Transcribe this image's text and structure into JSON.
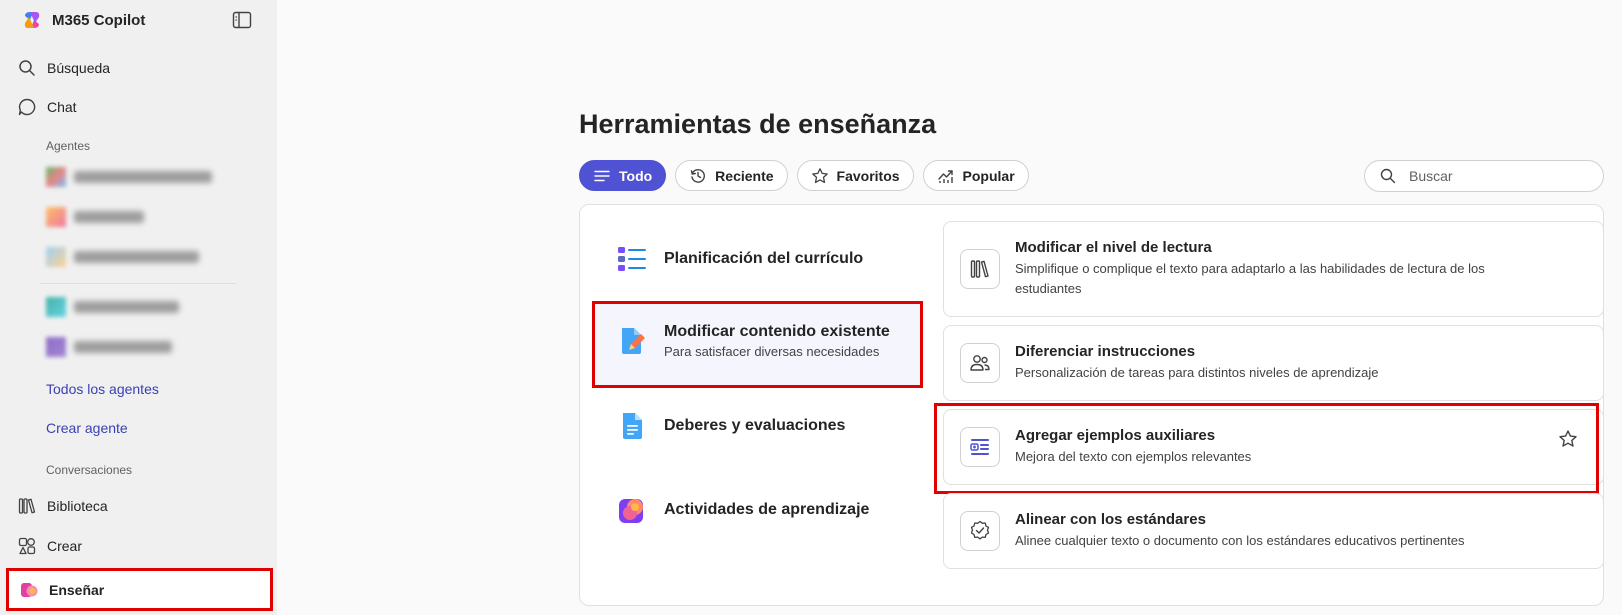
{
  "app": {
    "name": "M365 Copilot"
  },
  "sidebar": {
    "search_label": "Búsqueda",
    "chat_label": "Chat",
    "agents_heading": "Agentes",
    "all_agents_link": "Todos los agentes",
    "create_agent_link": "Crear agente",
    "conversations_heading": "Conversaciones",
    "library_label": "Biblioteca",
    "create_label": "Crear",
    "teach_label": "Enseñar"
  },
  "main": {
    "title": "Herramientas de enseñanza",
    "filters": [
      {
        "label": "Todo",
        "active": true
      },
      {
        "label": "Reciente",
        "active": false
      },
      {
        "label": "Favoritos",
        "active": false
      },
      {
        "label": "Popular",
        "active": false
      }
    ],
    "search_placeholder": "Buscar",
    "categories": [
      {
        "title": "Planificación del currículo",
        "subtitle": ""
      },
      {
        "title": "Modificar contenido existente",
        "subtitle": "Para satisfacer diversas necesidades",
        "selected": true
      },
      {
        "title": "Deberes y evaluaciones",
        "subtitle": ""
      },
      {
        "title": "Actividades de aprendizaje",
        "subtitle": ""
      }
    ],
    "tools": [
      {
        "title": "Modificar el nivel de lectura",
        "description": "Simplifique o complique el texto para adaptarlo a las habilidades de lectura de los estudiantes"
      },
      {
        "title": "Diferenciar instrucciones",
        "description": "Personalización de tareas para distintos niveles de aprendizaje"
      },
      {
        "title": "Agregar ejemplos auxiliares",
        "description": "Mejora del texto con ejemplos relevantes"
      },
      {
        "title": "Alinear con los estándares",
        "description": "Alinee cualquier texto o documento con los estándares educativos pertinentes"
      }
    ]
  },
  "colors": {
    "accent": "#4f52d2",
    "highlight": "#e00000",
    "link": "#3b3fb5"
  }
}
